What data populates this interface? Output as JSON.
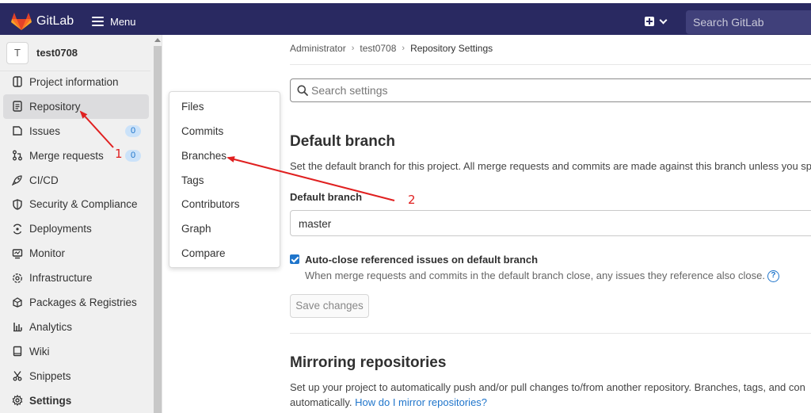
{
  "topbar": {
    "brand": "GitLab",
    "menu_label": "Menu",
    "search_placeholder": "Search GitLab"
  },
  "project": {
    "avatar_letter": "T",
    "name": "test0708"
  },
  "sidebar": {
    "items": [
      {
        "label": "Project information",
        "icon": "info-icon"
      },
      {
        "label": "Repository",
        "icon": "document-icon",
        "active": true
      },
      {
        "label": "Issues",
        "icon": "issues-icon",
        "badge": "0"
      },
      {
        "label": "Merge requests",
        "icon": "merge-request-icon",
        "badge": "0"
      },
      {
        "label": "CI/CD",
        "icon": "rocket-icon"
      },
      {
        "label": "Security & Compliance",
        "icon": "shield-icon"
      },
      {
        "label": "Deployments",
        "icon": "deployments-icon"
      },
      {
        "label": "Monitor",
        "icon": "monitor-icon"
      },
      {
        "label": "Infrastructure",
        "icon": "cloud-icon"
      },
      {
        "label": "Packages & Registries",
        "icon": "package-icon"
      },
      {
        "label": "Analytics",
        "icon": "chart-icon"
      },
      {
        "label": "Wiki",
        "icon": "book-icon"
      },
      {
        "label": "Snippets",
        "icon": "scissors-icon"
      },
      {
        "label": "Settings",
        "icon": "gear-icon"
      }
    ]
  },
  "flyout": {
    "items": [
      "Files",
      "Commits",
      "Branches",
      "Tags",
      "Contributors",
      "Graph",
      "Compare"
    ]
  },
  "breadcrumb": {
    "items": [
      "Administrator",
      "test0708",
      "Repository Settings"
    ]
  },
  "settings_search": {
    "placeholder": "Search settings"
  },
  "default_branch": {
    "title": "Default branch",
    "description": "Set the default branch for this project. All merge requests and commits are made against this branch unless you sp",
    "field_label": "Default branch",
    "value": "master",
    "checkbox_label": "Auto-close referenced issues on default branch",
    "checkbox_checked": true,
    "checkbox_help": "When merge requests and commits in the default branch close, any issues they reference also close.",
    "save_label": "Save changes"
  },
  "mirroring": {
    "title": "Mirroring repositories",
    "description_line1": "Set up your project to automatically push and/or pull changes to/from another repository. Branches, tags, and con",
    "description_line2": "automatically.",
    "help_link": "How do I mirror repositories?"
  },
  "annotations": {
    "step1": "1",
    "step2": "2",
    "color": "#e02020"
  },
  "colors": {
    "topbar": "#292961",
    "accent": "#1f75cb"
  }
}
